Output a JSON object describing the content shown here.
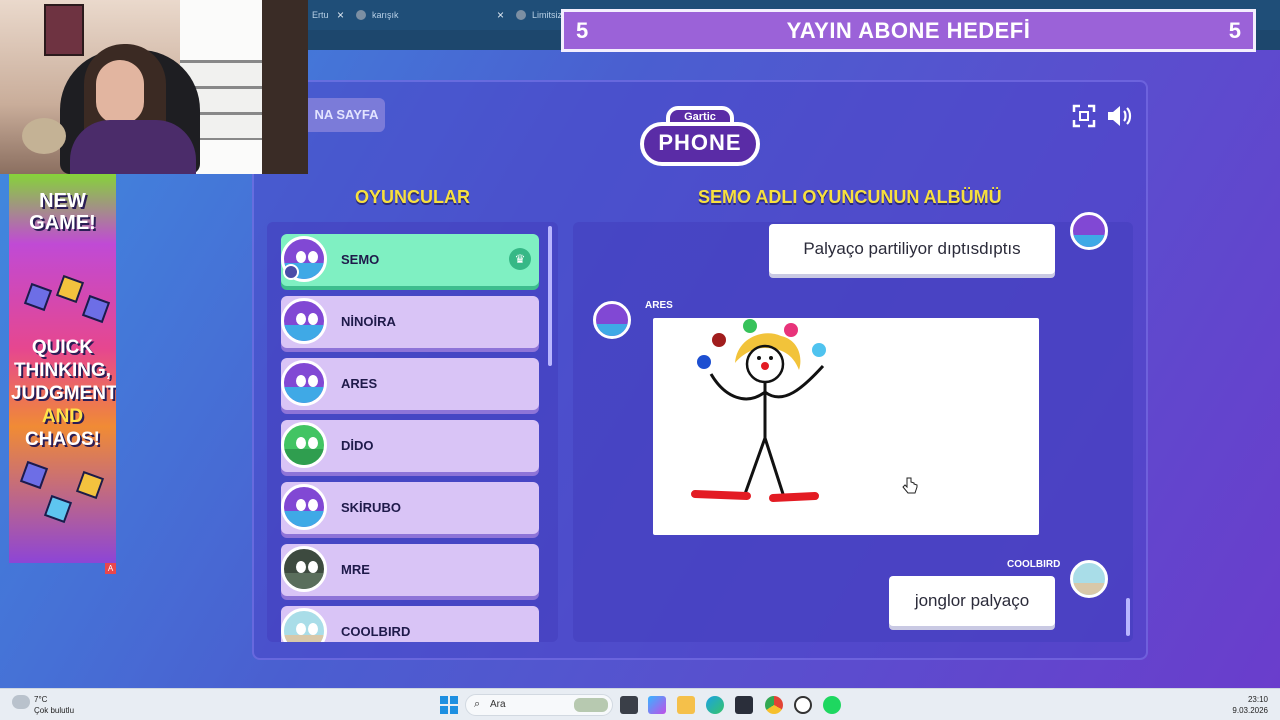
{
  "browser": {
    "tabs": [
      {
        "label": "Ertu"
      },
      {
        "label": "karışık"
      },
      {
        "label": "Limitsiz -"
      }
    ]
  },
  "goal_banner": {
    "left_count": "5",
    "title": "YAYIN ABONE HEDEFİ",
    "right_count": "5"
  },
  "ad": {
    "headline": "NEW GAME!",
    "line1": "QUICK",
    "line2": "THINKING,",
    "line3": "JUDGMENT",
    "line4": "AND",
    "line5": "CHAOS!",
    "badge": "A"
  },
  "game": {
    "back_button": "NA SAYFA",
    "logo_top": "Gartic",
    "logo_main": "PHONE",
    "players_title": "OYUNCULAR",
    "album_title": "SEMO ADLI OYUNCUNUN ALBÜMÜ",
    "players": [
      {
        "name": "SEMO",
        "active": true
      },
      {
        "name": "NİNOİRA"
      },
      {
        "name": "ARES"
      },
      {
        "name": "DİDO"
      },
      {
        "name": "SKİRUBO"
      },
      {
        "name": "MRE"
      },
      {
        "name": "COOLBIRD"
      }
    ],
    "album": {
      "msg1": "Palyaço partiliyor dıptısdıptıs",
      "author2": "ARES",
      "author3": "COOLBIRD",
      "msg3": "jonglor palyaço"
    }
  },
  "taskbar": {
    "temp": "7°C",
    "weather": "Çok bulutlu",
    "search_placeholder": "Ara",
    "time": "23:10",
    "date": "9.03.2026"
  },
  "icons": [
    "fullscreen-icon",
    "speaker-icon",
    "crown-icon",
    "windows-start-icon",
    "search-icon",
    "edge-icon",
    "chrome-icon",
    "spotify-icon",
    "folder-icon"
  ]
}
